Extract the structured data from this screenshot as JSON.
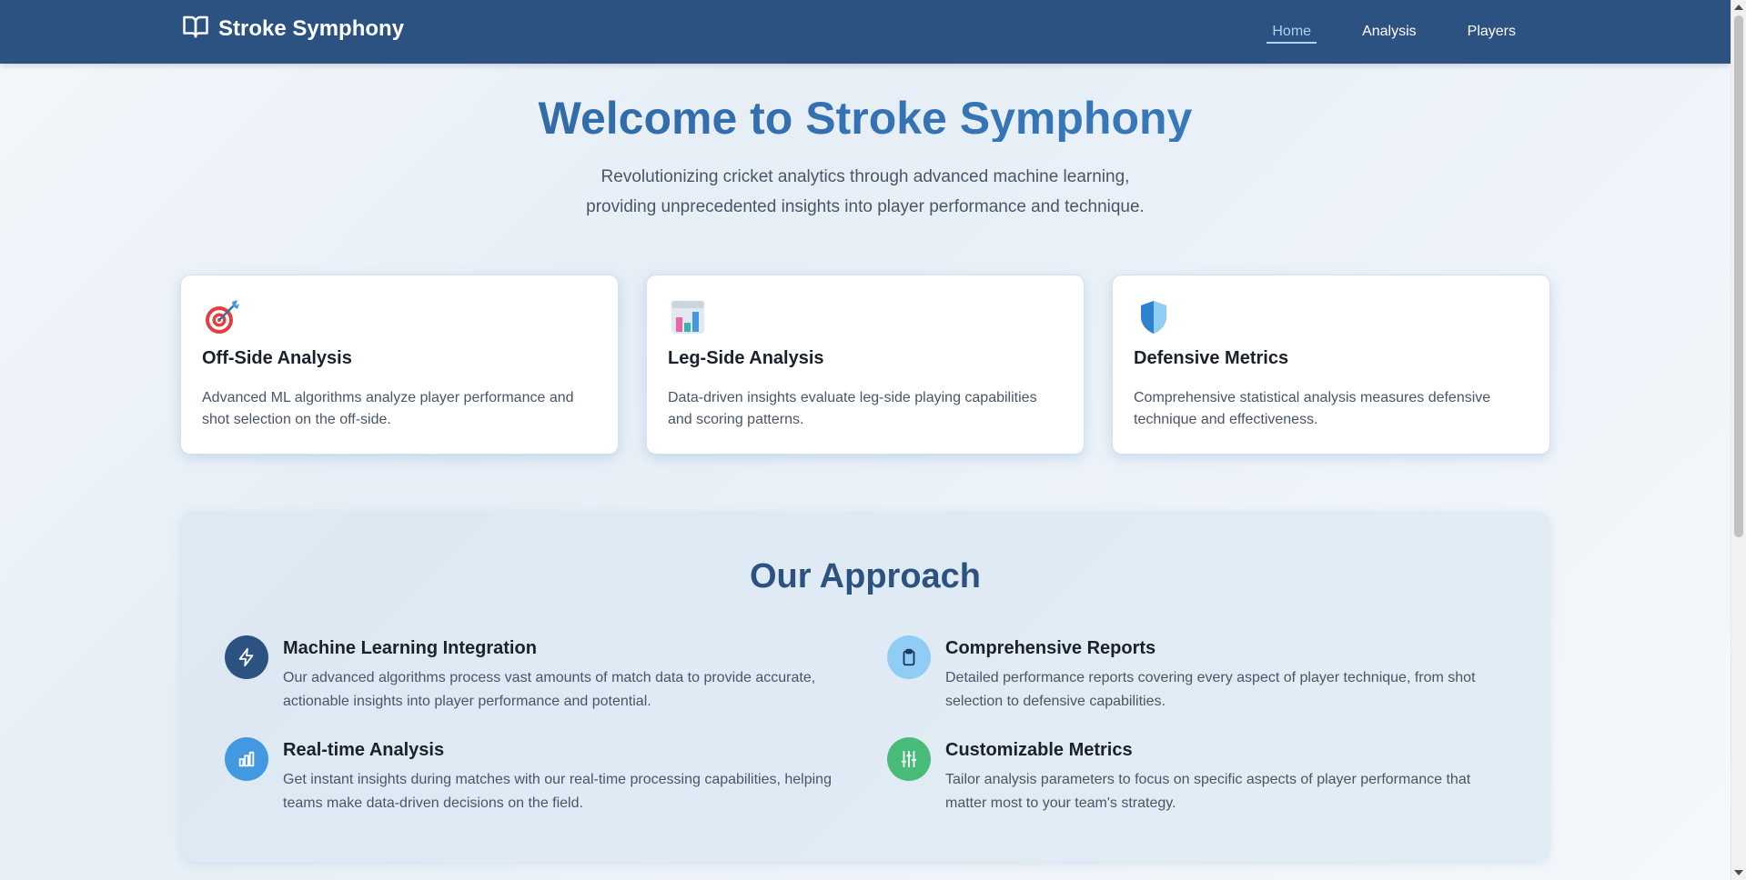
{
  "navbar": {
    "brand": "Stroke Symphony",
    "brand_icon": "book-open-icon",
    "links": [
      {
        "label": "Home",
        "active": true
      },
      {
        "label": "Analysis",
        "active": false
      },
      {
        "label": "Players",
        "active": false
      }
    ]
  },
  "hero": {
    "title": "Welcome to Stroke Symphony",
    "subtitle_line1": "Revolutionizing cricket analytics through advanced machine learning,",
    "subtitle_line2": "providing unprecedented insights into player performance and technique."
  },
  "features": [
    {
      "icon": "dart-target-icon",
      "title": "Off-Side Analysis",
      "description": "Advanced ML algorithms analyze player performance and shot selection on the off-side."
    },
    {
      "icon": "bar-chart-icon",
      "title": "Leg-Side Analysis",
      "description": "Data-driven insights evaluate leg-side playing capabilities and scoring patterns."
    },
    {
      "icon": "shield-icon",
      "title": "Defensive Metrics",
      "description": "Comprehensive statistical analysis measures defensive technique and effectiveness."
    }
  ],
  "approach": {
    "title": "Our Approach",
    "items": [
      {
        "icon": "lightning-icon",
        "color": "#2c5282",
        "title": "Machine Learning Integration",
        "description": "Our advanced algorithms process vast amounts of match data to provide accurate, actionable insights into player performance and potential."
      },
      {
        "icon": "clipboard-icon",
        "color": "#90cdf4",
        "title": "Comprehensive Reports",
        "description": "Detailed performance reports covering every aspect of player technique, from shot selection to defensive capabilities."
      },
      {
        "icon": "chart-icon",
        "color": "#4299e1",
        "title": "Real-time Analysis",
        "description": "Get instant insights during matches with our real-time processing capabilities, helping teams make data-driven decisions on the field."
      },
      {
        "icon": "sliders-icon",
        "color": "#48bb78",
        "title": "Customizable Metrics",
        "description": "Tailor analysis parameters to focus on specific aspects of player performance that matter most to your team's strategy."
      }
    ]
  }
}
